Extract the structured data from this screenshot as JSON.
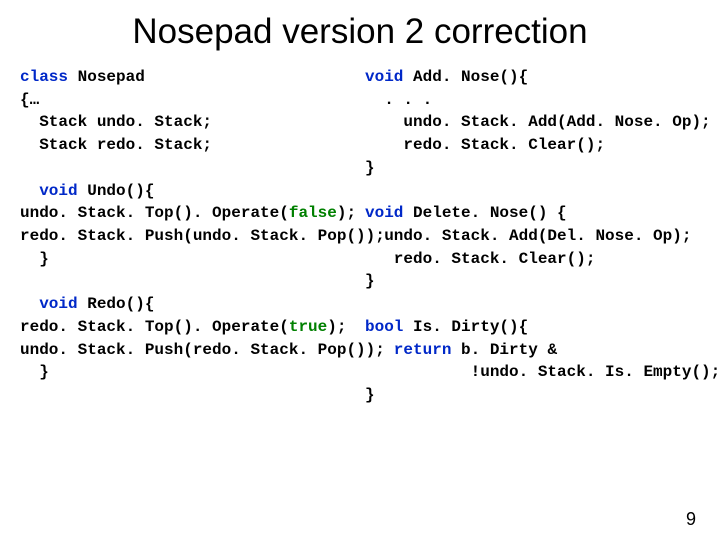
{
  "title": "Nosepad version 2 correction",
  "pagenum": "9",
  "left": {
    "l1a": "class",
    "l1b": " Nosepad",
    "l2": "{…",
    "l3": "  Stack undo. Stack;",
    "l4": "  Stack redo. Stack;",
    "l6a": "  void",
    "l6b": " Undo(){",
    "l7a": "undo. Stack. Top(). Operate(",
    "l7b": "false",
    "l7c": ");",
    "l8": "redo. Stack. Push(undo. Stack. Pop());",
    "l9": "  }",
    "l11a": "  void",
    "l11b": " Redo(){",
    "l12a": "redo. Stack. Top(). Operate(",
    "l12b": "true",
    "l12c": ");",
    "l13": "undo. Stack. Push(redo. Stack. Pop());",
    "l14": "  }"
  },
  "right": {
    "r1a": "void",
    "r1b": " Add. Nose(){",
    "r2": "  . . .",
    "r3": "    undo. Stack. Add(Add. Nose. Op);",
    "r4": "    redo. Stack. Clear();",
    "r5": "}",
    "r7a": "void",
    "r7b": " Delete. Nose() {",
    "r8": "  undo. Stack. Add(Del. Nose. Op);",
    "r9": "   redo. Stack. Clear();",
    "r10": "}",
    "r12a": "bool",
    "r12b": " Is. Dirty(){",
    "r13a": "   return",
    "r13b": " b. Dirty &",
    "r14": "           !undo. Stack. Is. Empty();",
    "r15": "}"
  }
}
